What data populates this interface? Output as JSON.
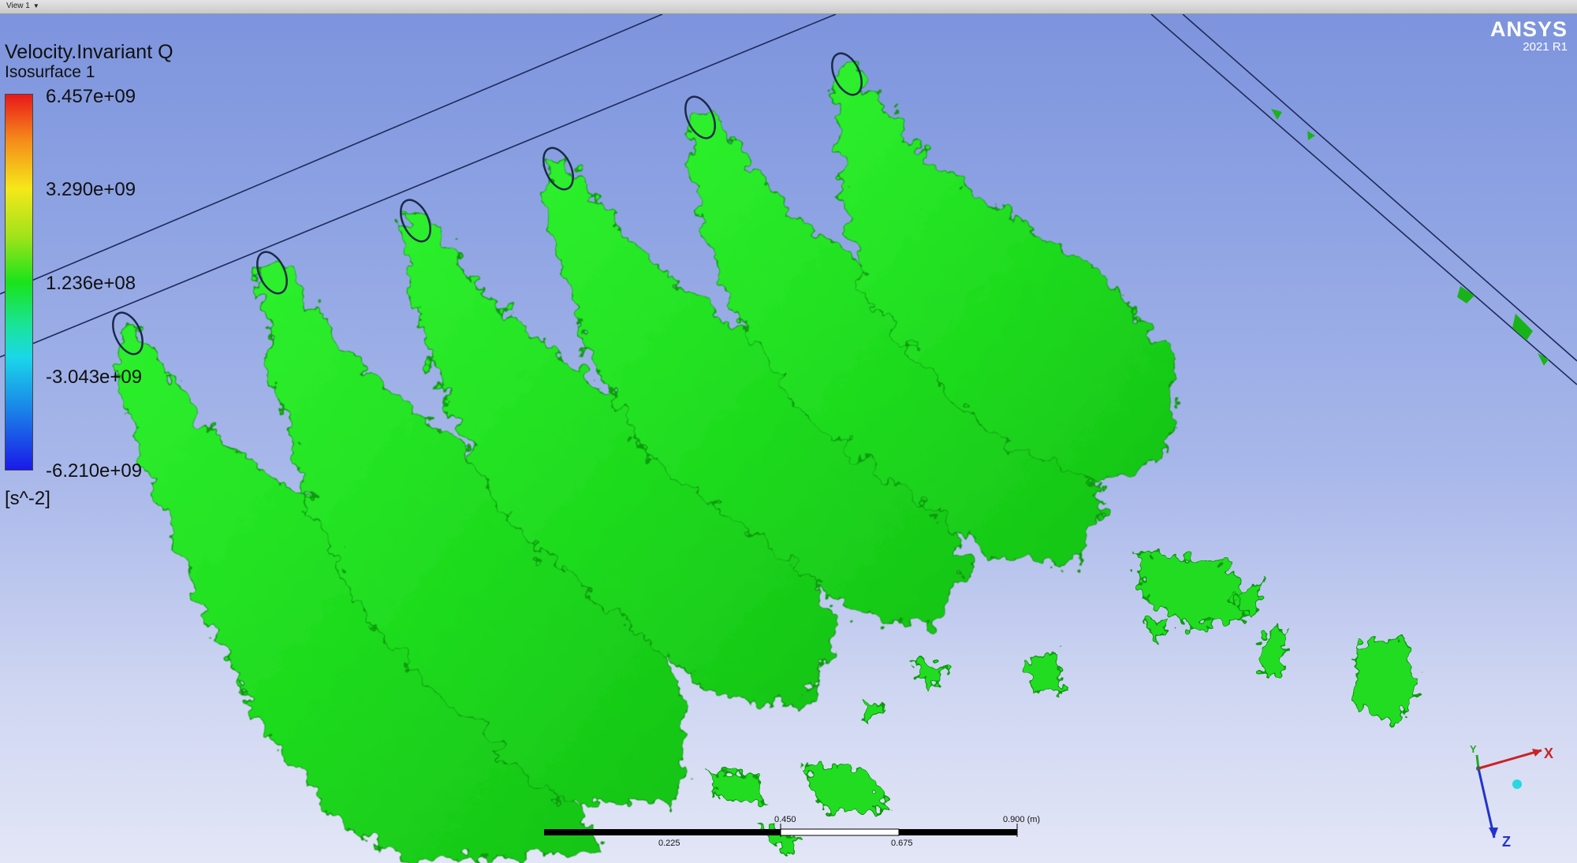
{
  "viewer": {
    "view_label": "View 1"
  },
  "legend": {
    "title": "Velocity.Invariant Q",
    "subtitle": "Isosurface 1",
    "ticks": [
      "6.457e+09",
      "3.290e+09",
      "1.236e+08",
      "-3.043e+09",
      "-6.210e+09"
    ],
    "units": "[s^-2]",
    "colors": {
      "max": "#e8181a",
      "mid": "#1ae31a",
      "min": "#1a1ae8"
    }
  },
  "logo": {
    "name": "ANSYS",
    "version": "2021 R1"
  },
  "scale_bar": {
    "labels_top": [
      "0.450",
      "0.900  (m)"
    ],
    "labels_bottom": [
      "0.225",
      "0.675"
    ]
  },
  "triad": {
    "x_label": "X",
    "y_label": "Y",
    "z_label": "Z"
  },
  "colors": {
    "isosurface": "#1fe01f",
    "background_top": "#7c93dd",
    "background_bottom": "#e3e6f6"
  }
}
